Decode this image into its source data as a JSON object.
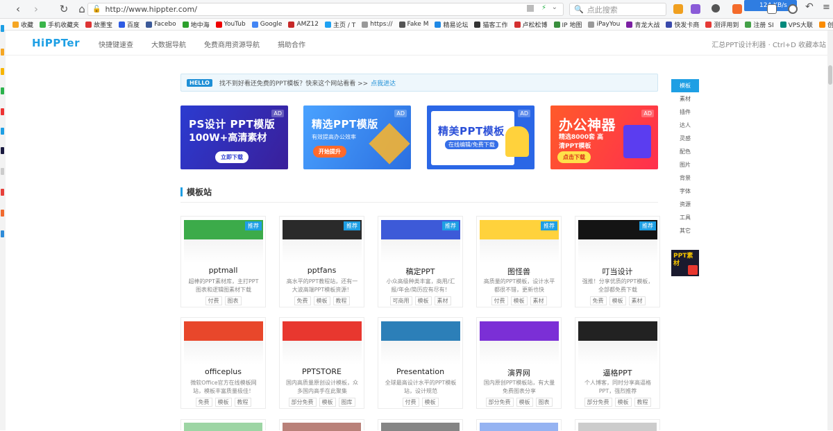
{
  "browser": {
    "url": "http://www.hippter.com/",
    "search_placeholder": "点此搜索",
    "speed": "124 KB/s",
    "bookmarks": [
      {
        "label": "收藏",
        "color": "#f5a623"
      },
      {
        "label": "手机收藏夹",
        "color": "#3ab54a"
      },
      {
        "label": "故墨宝",
        "color": "#d33"
      },
      {
        "label": "百度",
        "color": "#2d5be3"
      },
      {
        "label": "Facebo",
        "color": "#3b5998"
      },
      {
        "label": "地中海",
        "color": "#2ca02c"
      },
      {
        "label": "YouTub",
        "color": "#e00"
      },
      {
        "label": "Google",
        "color": "#4285f4"
      },
      {
        "label": "AMZ12",
        "color": "#c62828"
      },
      {
        "label": "主页 / T",
        "color": "#1da1f2"
      },
      {
        "label": "https://",
        "color": "#999"
      },
      {
        "label": "Fake M",
        "color": "#555"
      },
      {
        "label": "精易论坛",
        "color": "#1e88e5"
      },
      {
        "label": "猫客工作",
        "color": "#333"
      },
      {
        "label": "卢松松博",
        "color": "#d32f2f"
      },
      {
        "label": "IP 地图",
        "color": "#388e3c"
      },
      {
        "label": "iPayYou",
        "color": "#999"
      },
      {
        "label": "青龙大战",
        "color": "#7b1fa2"
      },
      {
        "label": "快发卡商",
        "color": "#3949ab"
      },
      {
        "label": "测评用到",
        "color": "#e53935"
      },
      {
        "label": "注册 SI",
        "color": "#43a047"
      },
      {
        "label": "VPS大联",
        "color": "#00897b"
      },
      {
        "label": "创蓝论坛",
        "color": "#fb8c00"
      }
    ]
  },
  "site": {
    "logo": "HiPPTer",
    "nav": [
      "快捷键速查",
      "大数据导航",
      "免费商用资源导航",
      "捐助合作"
    ],
    "header_right": "汇总PPT设计利器 · Ctrl+D 收藏本站",
    "notice": {
      "badge": "HELLO",
      "text": "找不到好看还免费的PPT模板？快来这个网站看看 >>",
      "link": "点我进达"
    },
    "banners": [
      {
        "ad": "AD",
        "line1": "PS设计 PPT模版",
        "line2": "100W+高清素材",
        "button": "立即下载",
        "bg": "#2f3fb0"
      },
      {
        "ad": "AD",
        "line1": "精选PPT模版",
        "sub": "有效提高办公效率",
        "button": "开始提升",
        "bg": "#3b8cf0"
      },
      {
        "ad": "AD",
        "line1": "精美PPT模板",
        "sub": "在线编辑/免费下载",
        "bg": "#2b67e6"
      },
      {
        "ad": "AD",
        "line1": "办公神器",
        "sub": "精选8000套 高清PPT模板",
        "button": "点击下载",
        "bg": "#ff4a2e"
      }
    ],
    "section_title": "模板站",
    "recommend_label": "推荐",
    "cards": [
      {
        "name": "pptmall",
        "desc": "超棒的PPT素材库，主打PPT图表和逻辑图素材下载",
        "tags": [
          "付费",
          "图表"
        ],
        "rec": true,
        "thumb": "#3cab4a"
      },
      {
        "name": "pptfans",
        "desc": "高水平的PPT教程站，还有一大波高端PPT模板资源！",
        "tags": [
          "免费",
          "模板",
          "教程"
        ],
        "rec": true,
        "thumb": "#2a2a2a"
      },
      {
        "name": "稿定PPT",
        "desc": "小众高级种类丰富，商用/汇报/年会/简历应有尽有！",
        "tags": [
          "可商用",
          "模板",
          "素材"
        ],
        "rec": true,
        "thumb": "#3d5ad8"
      },
      {
        "name": "图怪兽",
        "desc": "高质量的PPT模板，设计水平都很不错，更新也快",
        "tags": [
          "付费",
          "模板",
          "素材"
        ],
        "rec": true,
        "thumb": "#ffd23c"
      },
      {
        "name": "叮当设计",
        "desc": "强推！分享优质的PPT模板，全部都免费下载",
        "tags": [
          "免费",
          "模板",
          "素材"
        ],
        "rec": true,
        "thumb": "#141414"
      },
      {
        "name": "officeplus",
        "desc": "微软Office官方在线模板网站，模板丰富质量极佳！",
        "tags": [
          "免费",
          "模板",
          "教程"
        ],
        "rec": false,
        "thumb": "#e8472b"
      },
      {
        "name": "PPTSTORE",
        "desc": "国内高质量原创设计模板，众多国内高手在此聚集",
        "tags": [
          "部分免费",
          "模板",
          "图库"
        ],
        "rec": false,
        "thumb": "#e8372f"
      },
      {
        "name": "Presentation",
        "desc": "全球最高设计水平的PPT模板站，设计规范",
        "tags": [
          "付费",
          "模板"
        ],
        "rec": false,
        "thumb": "#2c7fb8"
      },
      {
        "name": "演界网",
        "desc": "国内原创PPT模板站，有大量免费图表分享",
        "tags": [
          "部分免费",
          "模板",
          "图表"
        ],
        "rec": false,
        "thumb": "#7b2fd6"
      },
      {
        "name": "逼格PPT",
        "desc": "个人博客，同时分享高逼格PPT，强烈推荐",
        "tags": [
          "部分免费",
          "模板",
          "教程"
        ],
        "rec": false,
        "thumb": "#222222"
      }
    ],
    "sidebar": [
      "模板",
      "素材",
      "插件",
      "达人",
      "灵感",
      "配色",
      "图片",
      "背景",
      "字体",
      "资源",
      "工具",
      "其它"
    ],
    "promo": "PPT素材"
  }
}
